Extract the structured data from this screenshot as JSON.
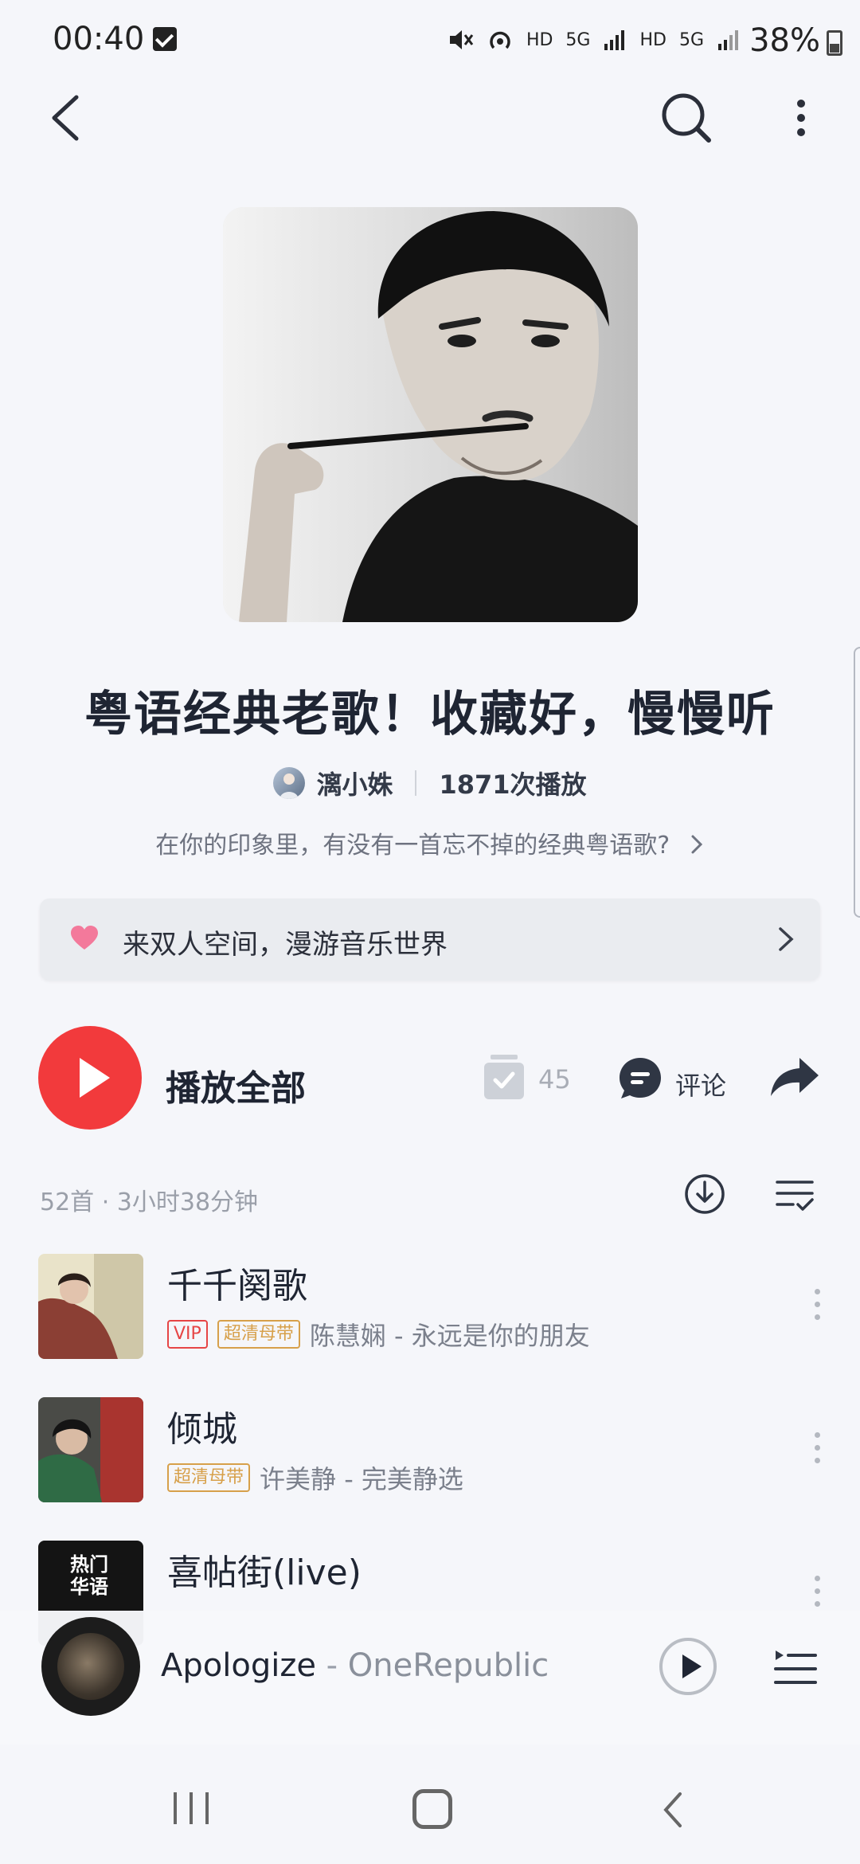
{
  "status_bar": {
    "time": "00:40",
    "icons": [
      "mute-icon",
      "hotspot-icon",
      "HD",
      "5G",
      "signal-icon",
      "HD",
      "5G",
      "signal-icon"
    ],
    "battery": "38%"
  },
  "playlist": {
    "title": "粤语经典老歌！收藏好，慢慢听",
    "creator": "漓小姝",
    "play_count": "1871次播放",
    "description": "在你的印象里，有没有一首忘不掉的经典粤语歌?",
    "banner_text": "来双人空间，漫游音乐世界"
  },
  "actions": {
    "play_all": "播放全部",
    "collect_count": "45",
    "comment": "评论"
  },
  "summary": "52首 · 3小时38分钟",
  "songs": [
    {
      "title": "千千阕歌",
      "tags": [
        "VIP",
        "超清母带"
      ],
      "artist_album": "陈慧娴 - 永远是你的朋友"
    },
    {
      "title": "倾城",
      "tags": [
        "超清母带"
      ],
      "artist_album": "许美静 - 完美静选"
    },
    {
      "title": "喜帖街(live)",
      "cover_text": [
        "热门",
        "华语"
      ]
    }
  ],
  "now_playing": {
    "title": "Apologize",
    "separator": " - ",
    "artist": "OneRepublic"
  },
  "colors": {
    "accent_red": "#f23a3c",
    "tag_vip": "#e64545",
    "tag_hq": "#d7a04a",
    "background": "#f5f6fa"
  }
}
